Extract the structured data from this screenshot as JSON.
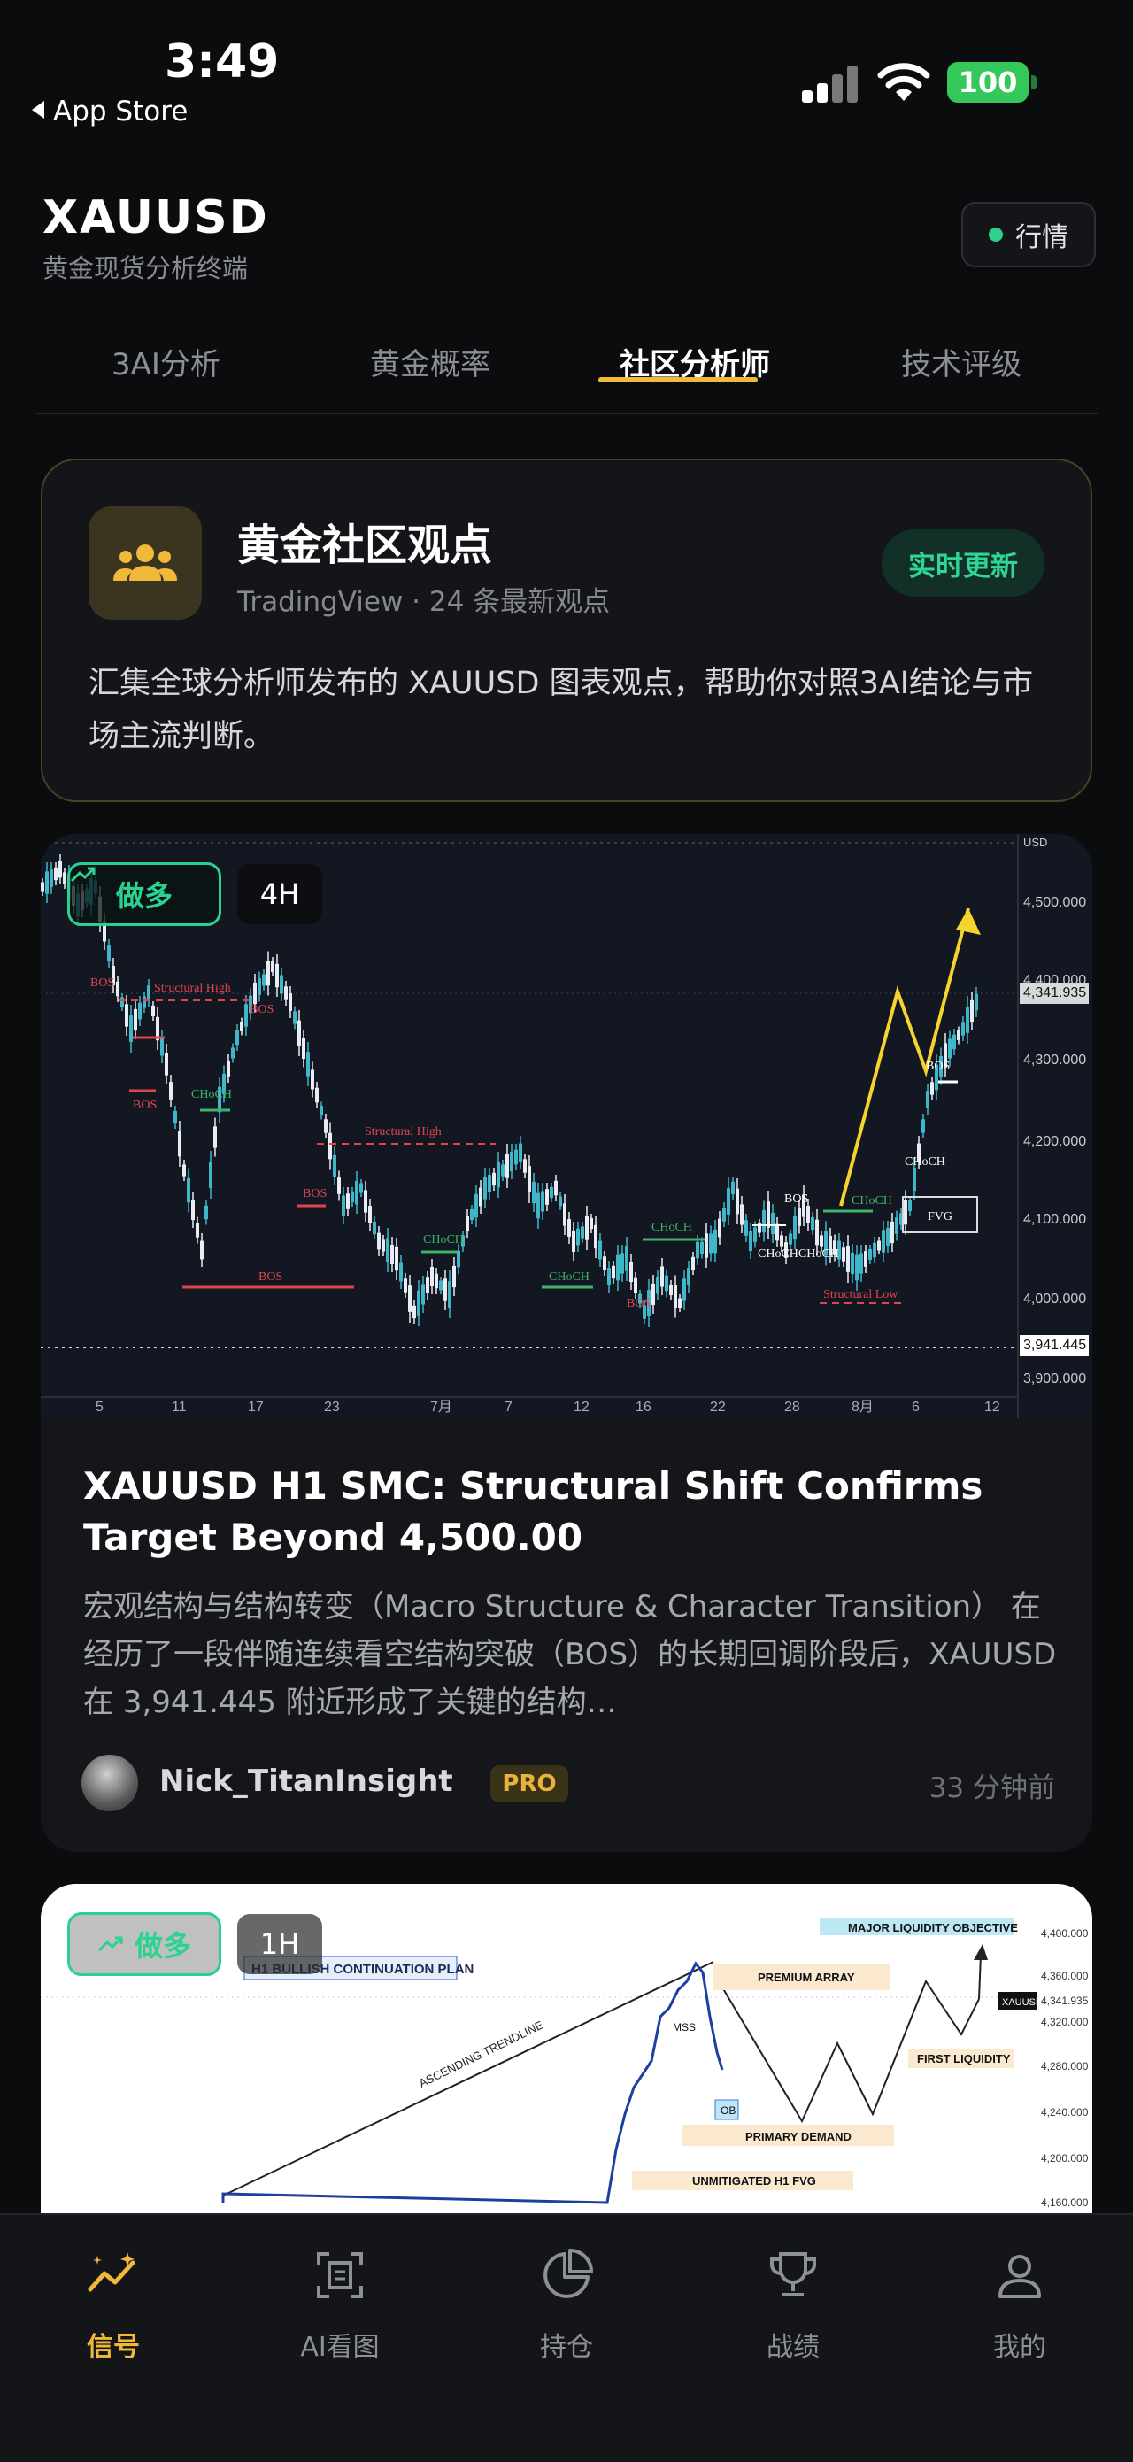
{
  "status_bar": {
    "time": "3:49",
    "back_app": "App Store",
    "battery": "100"
  },
  "header": {
    "title": "XAUUSD",
    "subtitle": "黄金现货分析终端",
    "market_button": "行情"
  },
  "tabs": [
    {
      "label": "3AI分析",
      "active": false
    },
    {
      "label": "黄金概率",
      "active": false
    },
    {
      "label": "社区分析师",
      "active": true
    },
    {
      "label": "技术评级",
      "active": false
    }
  ],
  "intro_card": {
    "title": "黄金社区观点",
    "source": "TradingView · 24 条最新观点",
    "live_badge": "实时更新",
    "description": "汇集全球分析师发布的 XAUUSD 图表观点，帮助你对照3AI结论与市场主流判断。",
    "icon": "community-icon"
  },
  "posts": [
    {
      "direction": "做多",
      "timeframe": "4H",
      "headline": "XAUUSD H1 SMC: Structural Shift Confirms Target Beyond 4,500.00",
      "summary": "宏观结构与结构转变（Macro Structure & Character Transition） 在经历了一段伴随连续看空结构突破（BOS）的长期回调阶段后，XAUUSD 在 3,941.445 附近形成了关键的结构…",
      "author": "Nick_TitanInsight",
      "author_badge": "PRO",
      "time_ago": "33 分钟前"
    },
    {
      "direction": "做多",
      "timeframe": "1H"
    }
  ],
  "chart_1": {
    "currency": "USD",
    "price_ticks": [
      "4,500.000",
      "4,400.000",
      "4,341.935",
      "4,300.000",
      "4,200.000",
      "4,100.000",
      "4,000.000",
      "3,941.445",
      "3,900.000"
    ],
    "date_ticks": [
      "5",
      "11",
      "17",
      "23",
      "7月",
      "7",
      "12",
      "16",
      "22",
      "28",
      "8月",
      "6",
      "12"
    ],
    "annotations": [
      "BOS",
      "Structural High",
      "BOS",
      "BOS",
      "CHoCH",
      "Structural High",
      "BOS",
      "BOS",
      "CHoCH",
      "CHoCH",
      "CHoCH",
      "BOS",
      "BOS",
      "CHoCH",
      "CHoCH",
      "CHoCH",
      "Structural Low",
      "CHoCH",
      "FVG",
      "BOS",
      "CHoCH"
    ]
  },
  "chart_2": {
    "header": "H1 BULLISH CONTINUATION PLAN",
    "labels": [
      "MAJOR LIQUIDITY OBJECTIVE",
      "PREMIUM ARRAY",
      "FIRST LIQUIDITY",
      "MSS",
      "OB",
      "PRIMARY DEMAND",
      "UNMITIGATED H1 FVG",
      "ASCENDING TRENDLINE"
    ],
    "price_ticks": [
      "4,400.000",
      "4,360.000",
      "4,341.935",
      "4,320.000",
      "4,280.000",
      "4,240.000",
      "4,200.000",
      "4,160.000"
    ],
    "symbol_tag": "XAUUSD"
  },
  "bottom_nav": [
    {
      "label": "信号",
      "icon": "signal-sparkle-icon",
      "active": true
    },
    {
      "label": "AI看图",
      "icon": "ai-scan-icon",
      "active": false
    },
    {
      "label": "持仓",
      "icon": "pie-chart-icon",
      "active": false
    },
    {
      "label": "战绩",
      "icon": "trophy-icon",
      "active": false
    },
    {
      "label": "我的",
      "icon": "user-icon",
      "active": false
    }
  ],
  "colors": {
    "accent_gold": "#f0b93a",
    "bull_green": "#2bd391",
    "bear_red": "#e0454e",
    "background": "#0b0c0e"
  }
}
